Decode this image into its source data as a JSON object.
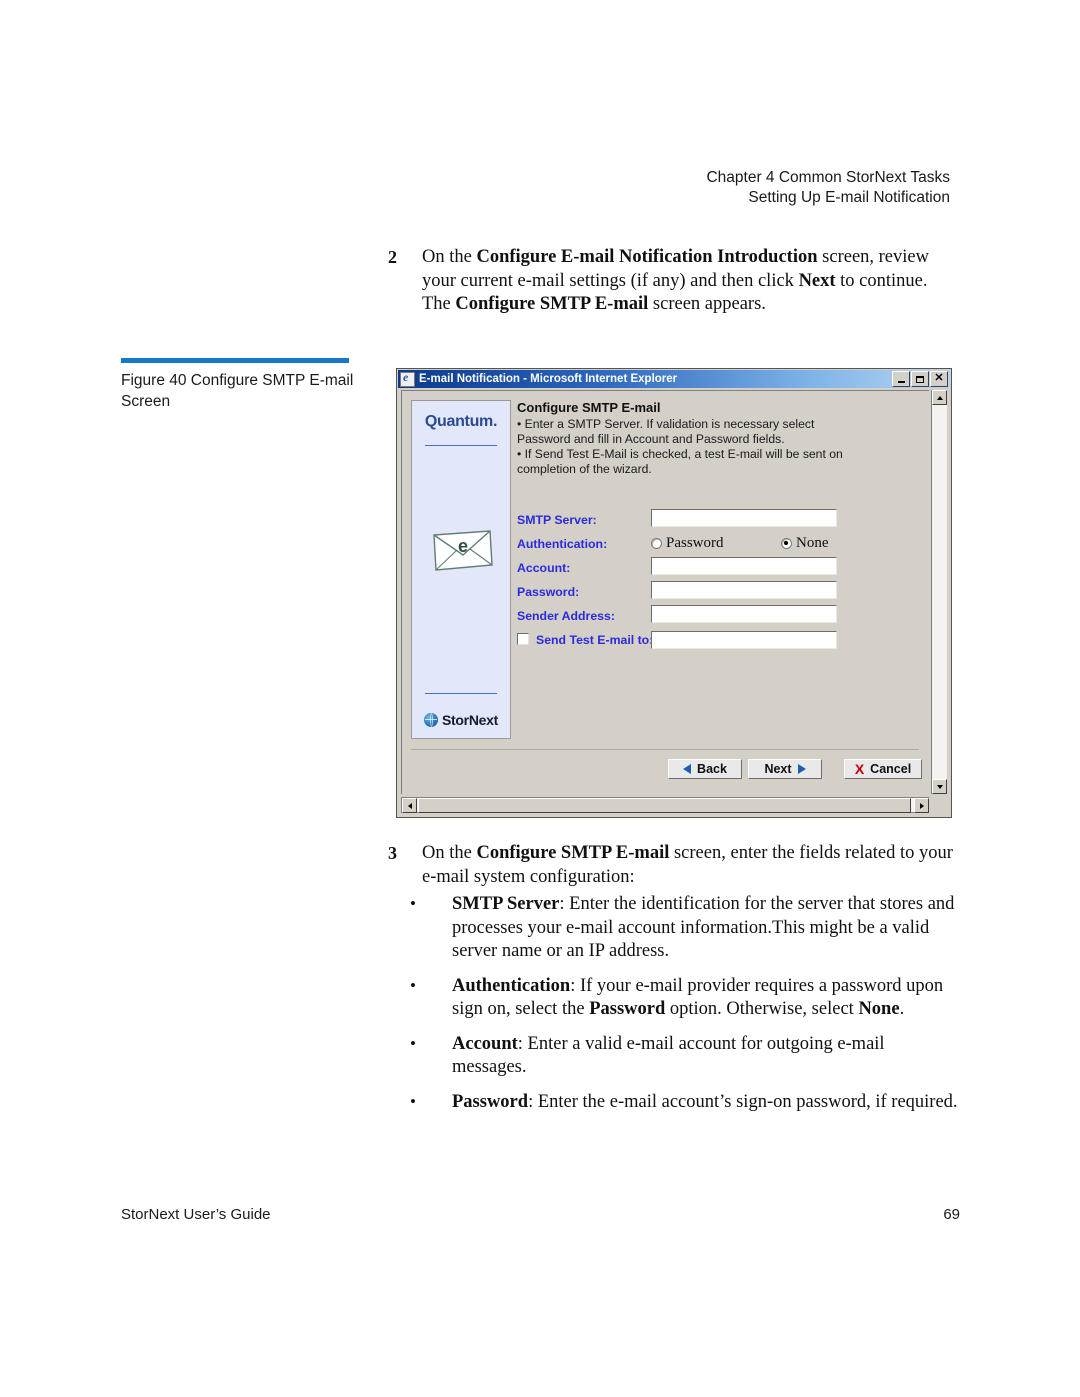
{
  "page": {
    "running_head_line1": "Chapter 4  Common StorNext Tasks",
    "running_head_line2": "Setting Up E-mail Notification",
    "footer_left": "StorNext User’s Guide",
    "footer_page_number": "69"
  },
  "figure": {
    "caption": "Figure 40  Configure SMTP E-mail Screen",
    "rule_color": "#1878c8"
  },
  "step2": {
    "number": "2",
    "part1": "On the ",
    "bold1": "Configure E-mail Notification Introduction",
    "part2": " screen, review your current e-mail settings (if any) and then click ",
    "bold2": "Next",
    "part3": " to continue. The ",
    "bold3": "Configure SMTP E-mail",
    "part4": " screen appears."
  },
  "step3": {
    "number": "3",
    "part1": "On the ",
    "bold1": "Configure SMTP E-mail",
    "part2": " screen, enter the fields related to your e-mail system configuration:"
  },
  "bullets": [
    {
      "marker": "•",
      "term": "SMTP Server",
      "text": ": Enter the identification for the server that stores and processes your e-mail account information.This might be a valid server name or an IP address."
    },
    {
      "marker": "•",
      "term": "Authentication",
      "text": ": If your e-mail provider requires a password upon sign on, select the ",
      "bold_mid": "Password",
      "text2": " option. Otherwise, select ",
      "bold_end": "None",
      "text3": "."
    },
    {
      "marker": "•",
      "term": "Account",
      "text": ": Enter a valid e-mail account for outgoing e-mail messages."
    },
    {
      "marker": "•",
      "term": "Password",
      "text": ": Enter the e-mail account’s sign-on password, if required."
    }
  ],
  "screenshot": {
    "window": {
      "title": "E-mail Notification - Microsoft Internet Explorer",
      "icon": "internet-explorer-icon",
      "minimize_label": "",
      "maximize_label": "",
      "close_label": "✕"
    },
    "brand_panel": {
      "quantum_logo_text": "Quantum.",
      "envelope_icon_letter": "e",
      "stornext_logo_text": "StorNext"
    },
    "form": {
      "heading": "Configure SMTP E-mail",
      "note_line1": "•  Enter a SMTP Server. If validation is necessary select",
      "note_line2": "Password and fill in Account and Password fields.",
      "note_line3": "•  If Send Test E-Mail is checked, a test E-mail will be sent on",
      "note_line4": "completion of the wizard.",
      "fields": [
        {
          "label": "SMTP Server:",
          "type": "text",
          "value": ""
        },
        {
          "label": "Authentication:",
          "type": "radio",
          "options": [
            {
              "label": "Password",
              "selected": false
            },
            {
              "label": "None",
              "selected": true
            }
          ]
        },
        {
          "label": "Account:",
          "type": "text",
          "value": ""
        },
        {
          "label": "Password:",
          "type": "text",
          "value": ""
        },
        {
          "label": "Sender Address:",
          "type": "text",
          "value": ""
        }
      ],
      "send_test": {
        "label": "Send Test E-mail to:",
        "checked": false,
        "value": ""
      },
      "label_color": "#2a2ae0"
    },
    "buttons": {
      "back": "Back",
      "next": "Next",
      "cancel": "Cancel",
      "cancel_icon": "X"
    }
  }
}
